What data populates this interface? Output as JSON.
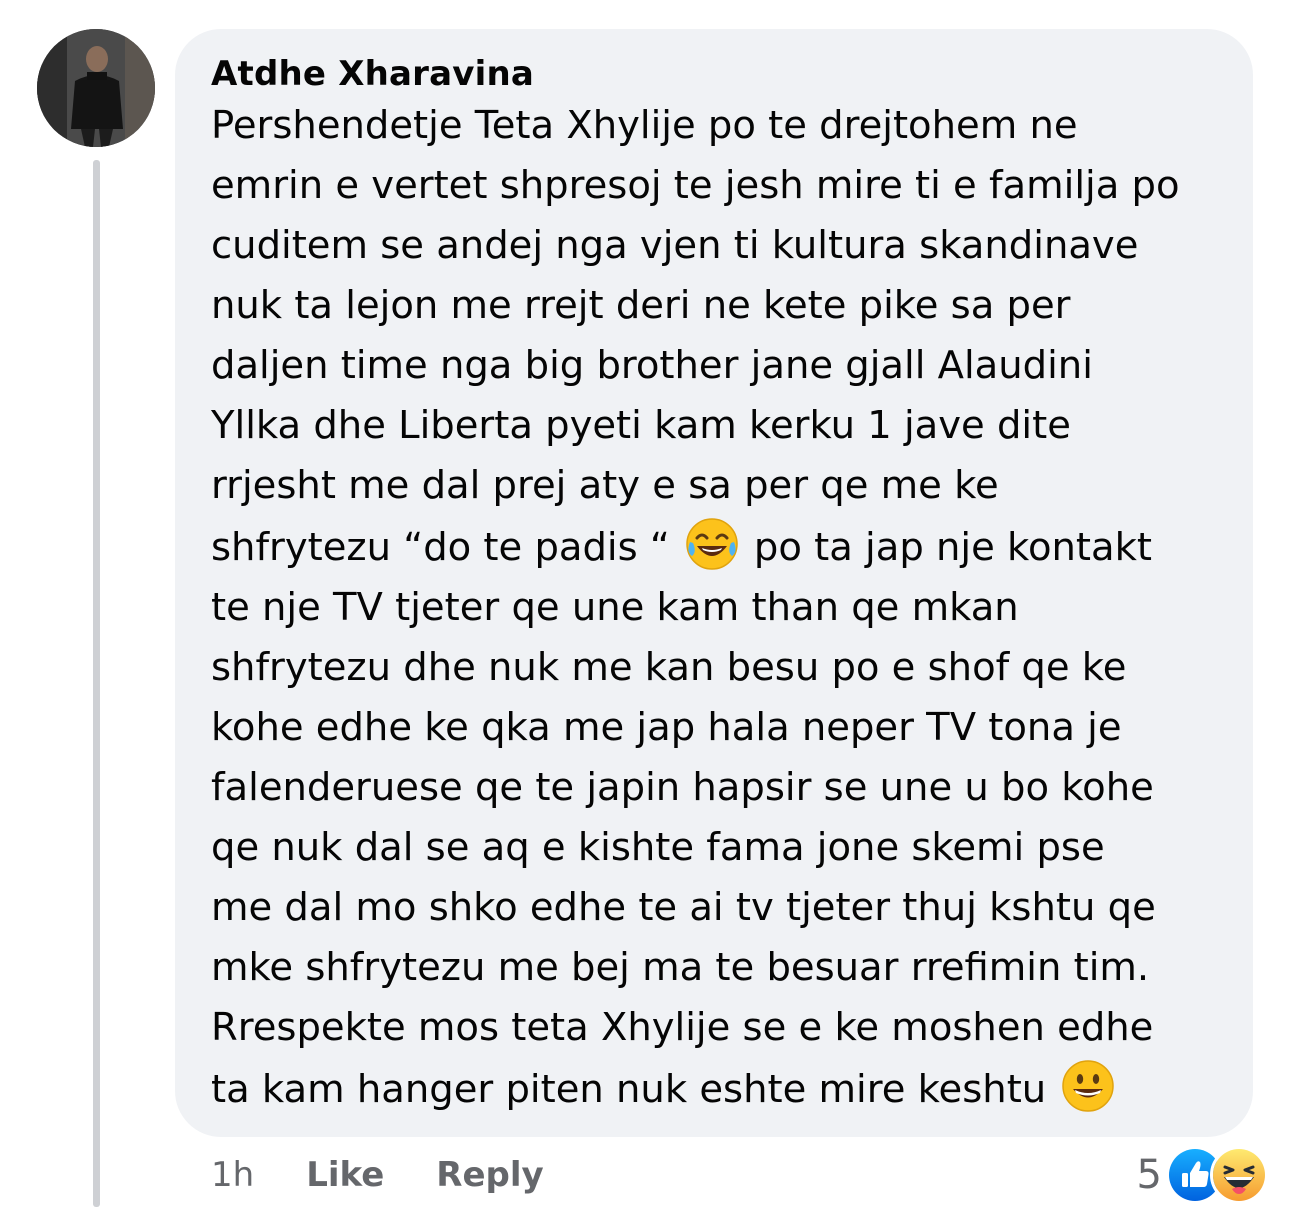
{
  "comment": {
    "author": "Atdhe Xharavina",
    "lines": [
      "Pershendetje Teta Xhylije po te drejtohem ne",
      "emrin e vertet shpresoj te jesh mire ti e familja po",
      "cuditem se andej nga vjen ti kultura skandinave",
      "nuk ta lejon me rrejt deri ne kete pike sa per",
      "daljen time nga big brother jane gjall Alaudini",
      "Yllka dhe Liberta pyeti kam kerku 1 jave dite",
      "rrjesht me dal prej aty e sa per qe me ke"
    ],
    "line8_before": "shfrytezu “do te padis “",
    "line8_after": "po ta jap nje kontakt",
    "lines_rest": [
      "te nje TV tjeter qe une kam than qe mkan",
      "shfrytezu dhe nuk me kan besu po e shof qe ke",
      "kohe edhe ke qka me jap hala neper TV tona je",
      "falenderuese qe te japin hapsir se une u bo kohe",
      "qe nuk dal se aq e kishte fama jone skemi pse",
      "me dal mo shko edhe te ai tv tjeter thuj kshtu qe",
      "mke shfrytezu me bej ma te besuar rrefimin tim.",
      "Rrespekte mos teta Xhylije se e ke moshen edhe"
    ],
    "last_line": "ta kam hanger piten nuk eshte mire keshtu",
    "inline_emojis": [
      "face-with-tears-of-joy-emoji",
      "grinning-face-emoji"
    ]
  },
  "actions": {
    "time": "1h",
    "like_label": "Like",
    "reply_label": "Reply"
  },
  "reactions": {
    "count": "5",
    "icons": [
      "like-icon",
      "haha-icon"
    ],
    "like_color": "#1877f2",
    "haha_color": "#f7b125"
  }
}
